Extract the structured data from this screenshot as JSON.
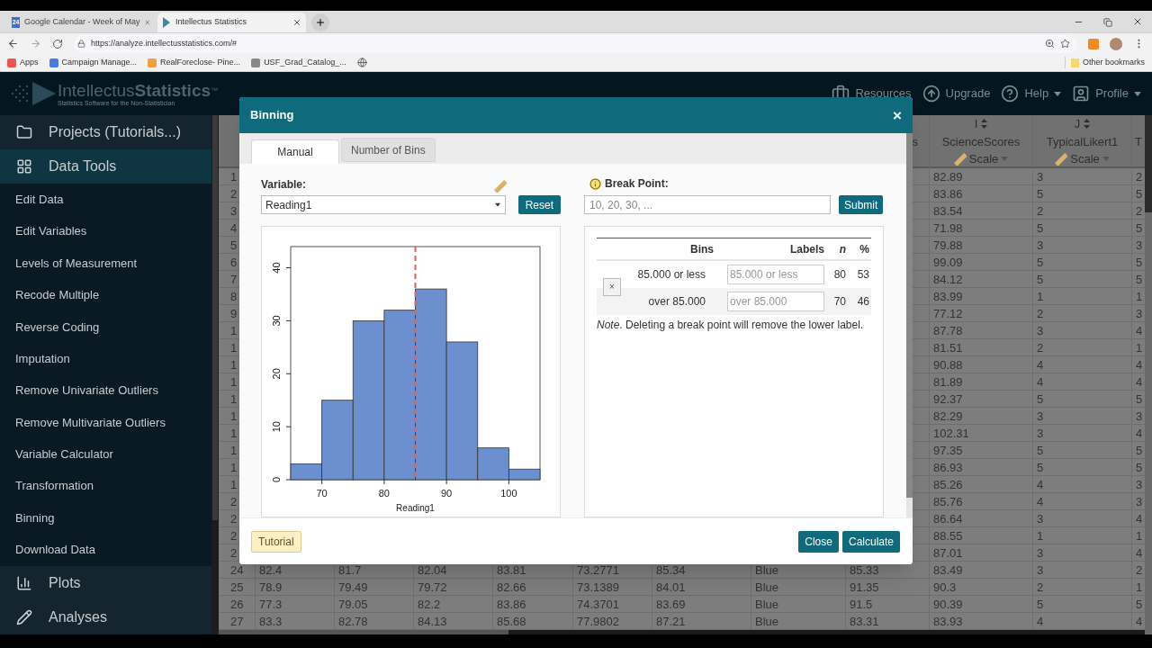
{
  "browser": {
    "tabs": [
      {
        "title": "Google Calendar - Week of May",
        "icon_text": "24",
        "selected": false
      },
      {
        "title": "Intellectus Statistics",
        "selected": true
      }
    ],
    "url": "https://analyze.intellectusstatistics.com/#",
    "bookmarks": [
      "Apps",
      "Campaign Manage...",
      "RealForeclose- Pine...",
      "USF_Grad_Catalog_..."
    ],
    "other_bookmarks": "Other bookmarks"
  },
  "app_header": {
    "logo_light": "Intellectus",
    "logo_bold": "Statistics",
    "logo_mark": "™",
    "tagline": "Statistics Software for the Non-Statistician",
    "nav": [
      {
        "label": "Resources",
        "kind": "briefcase",
        "dropdown": false
      },
      {
        "label": "Upgrade",
        "kind": "upgrade",
        "dropdown": false
      },
      {
        "label": "Help",
        "kind": "help",
        "dropdown": true
      },
      {
        "label": "Profile",
        "kind": "profile",
        "dropdown": true
      }
    ]
  },
  "sidebar": {
    "items": [
      {
        "label": "Projects (Tutorials...)",
        "kind": "folder",
        "expanded": false
      },
      {
        "label": "Data Tools",
        "kind": "grid",
        "expanded": true
      },
      {
        "label": "Edit Data",
        "kind": "item"
      },
      {
        "label": "Edit Variables",
        "kind": "item"
      },
      {
        "label": "Levels of Measurement",
        "kind": "item"
      },
      {
        "label": "Recode Multiple",
        "kind": "item"
      },
      {
        "label": "Reverse Coding",
        "kind": "item"
      },
      {
        "label": "Imputation",
        "kind": "item"
      },
      {
        "label": "Remove Univariate Outliers",
        "kind": "item"
      },
      {
        "label": "Remove Multivariate Outliers",
        "kind": "item"
      },
      {
        "label": "Variable Calculator",
        "kind": "item"
      },
      {
        "label": "Transformation",
        "kind": "item"
      },
      {
        "label": "Binning",
        "kind": "item"
      },
      {
        "label": "Download Data",
        "kind": "item"
      },
      {
        "label": "Plots",
        "kind": "chart",
        "expanded": false
      },
      {
        "label": "Analyses",
        "kind": "pencil",
        "expanded": false
      }
    ]
  },
  "table": {
    "columns": [
      {},
      {},
      {},
      {},
      {},
      {},
      {},
      {
        "name": "s"
      },
      {
        "letter": "I",
        "name": "ScienceScores",
        "measure": "Scale"
      },
      {
        "letter": "J",
        "name": "TypicalLikert1",
        "measure": "Scale"
      },
      {
        "name": "T"
      }
    ],
    "rows": [
      {
        "number": "1",
        "cells": [
          "",
          "",
          "",
          "",
          "",
          "",
          "",
          "",
          "82.89",
          "3",
          "2"
        ]
      },
      {
        "number": "2",
        "cells": [
          "",
          "",
          "",
          "",
          "",
          "",
          "",
          "",
          "83.86",
          "5",
          "5"
        ]
      },
      {
        "number": "3",
        "cells": [
          "",
          "",
          "",
          "",
          "",
          "",
          "",
          "",
          "83.54",
          "2",
          "2"
        ]
      },
      {
        "number": "4",
        "cells": [
          "",
          "",
          "",
          "",
          "",
          "",
          "",
          "",
          "71.98",
          "5",
          "5"
        ]
      },
      {
        "number": "5",
        "cells": [
          "",
          "",
          "",
          "",
          "",
          "",
          "",
          "",
          "79.88",
          "3",
          "3"
        ]
      },
      {
        "number": "6",
        "cells": [
          "",
          "",
          "",
          "",
          "",
          "",
          "",
          "",
          "99.09",
          "5",
          "5"
        ]
      },
      {
        "number": "7",
        "cells": [
          "",
          "",
          "",
          "",
          "",
          "",
          "",
          "",
          "84.12",
          "5",
          "5"
        ]
      },
      {
        "number": "8",
        "cells": [
          "",
          "",
          "",
          "",
          "",
          "",
          "",
          "",
          "83.99",
          "1",
          "1"
        ]
      },
      {
        "number": "9",
        "cells": [
          "",
          "",
          "",
          "",
          "",
          "",
          "",
          "",
          "77.12",
          "2",
          "3"
        ]
      },
      {
        "number": "1",
        "cells": [
          "",
          "",
          "",
          "",
          "",
          "",
          "",
          "",
          "87.78",
          "3",
          "4"
        ]
      },
      {
        "number": "1",
        "cells": [
          "",
          "",
          "",
          "",
          "",
          "",
          "",
          "",
          "81.51",
          "2",
          "1"
        ]
      },
      {
        "number": "1",
        "cells": [
          "",
          "",
          "",
          "",
          "",
          "",
          "",
          "",
          "90.88",
          "4",
          "4"
        ]
      },
      {
        "number": "1",
        "cells": [
          "",
          "",
          "",
          "",
          "",
          "",
          "",
          "",
          "81.89",
          "4",
          "4"
        ]
      },
      {
        "number": "1",
        "cells": [
          "",
          "",
          "",
          "",
          "",
          "",
          "",
          "",
          "92.37",
          "5",
          "5"
        ]
      },
      {
        "number": "1",
        "cells": [
          "",
          "",
          "",
          "",
          "",
          "",
          "",
          "",
          "82.29",
          "3",
          "3"
        ]
      },
      {
        "number": "1",
        "cells": [
          "",
          "",
          "",
          "",
          "",
          "",
          "",
          "",
          "102.31",
          "3",
          "4"
        ]
      },
      {
        "number": "1",
        "cells": [
          "",
          "",
          "",
          "",
          "",
          "",
          "",
          "",
          "97.35",
          "5",
          "5"
        ]
      },
      {
        "number": "1",
        "cells": [
          "",
          "",
          "",
          "",
          "",
          "",
          "",
          "",
          "86.93",
          "5",
          "5"
        ]
      },
      {
        "number": "1",
        "cells": [
          "",
          "",
          "",
          "",
          "",
          "",
          "",
          "",
          "85.26",
          "4",
          "3"
        ]
      },
      {
        "number": "2",
        "cells": [
          "",
          "",
          "",
          "",
          "",
          "",
          "",
          "",
          "85.76",
          "4",
          "3"
        ]
      },
      {
        "number": "2",
        "cells": [
          "",
          "",
          "",
          "",
          "",
          "",
          "",
          "",
          "86.64",
          "3",
          "4"
        ]
      },
      {
        "number": "2",
        "cells": [
          "",
          "",
          "",
          "",
          "",
          "",
          "",
          "",
          "88.55",
          "1",
          "1"
        ]
      },
      {
        "number": "2",
        "cells": [
          "",
          "",
          "",
          "",
          "",
          "",
          "",
          "",
          "87.01",
          "3",
          "4"
        ]
      },
      {
        "number": "24",
        "cells": [
          "82.4",
          "81.7",
          "82.04",
          "83.81",
          "73.2771",
          "85.34",
          "Blue",
          "85.33",
          "83.49",
          "3",
          "2"
        ]
      },
      {
        "number": "25",
        "cells": [
          "78.9",
          "79.49",
          "79.72",
          "82.66",
          "73.1389",
          "84.01",
          "Blue",
          "91.35",
          "90.3",
          "2",
          "1"
        ]
      },
      {
        "number": "26",
        "cells": [
          "77.3",
          "79.05",
          "82.2",
          "83.86",
          "74.3701",
          "83.69",
          "Blue",
          "91.5",
          "90.39",
          "5",
          "5"
        ]
      },
      {
        "number": "27",
        "cells": [
          "83.3",
          "82.78",
          "84.13",
          "85.68",
          "77.9802",
          "87.21",
          "Blue",
          "83.31",
          "83.93",
          "4",
          "4"
        ]
      }
    ]
  },
  "dialog": {
    "title": "Binning",
    "close": "×",
    "tabs": [
      {
        "label": "Manual",
        "selected": true
      },
      {
        "label": "Number of Bins",
        "selected": false
      }
    ],
    "variable_label": "Variable:",
    "variable_value": "Reading1",
    "reset": "Reset",
    "break_label": "Break Point:",
    "break_placeholder": "10, 20, 30, ...",
    "submit": "Submit",
    "chart_data": {
      "type": "bar",
      "xlabel": "Reading1",
      "x": [
        67.5,
        72.5,
        77.5,
        82.5,
        87.5,
        92.5,
        97.5,
        102.5
      ],
      "series": [
        {
          "color": "#6b8fcf",
          "values": [
            3,
            15,
            30,
            32,
            36,
            26,
            6,
            2
          ]
        }
      ],
      "xlim": [
        65,
        105
      ],
      "ylim": [
        0,
        44
      ],
      "xticks": [
        {
          "value": 70,
          "label": "70"
        },
        {
          "value": 80,
          "label": "80"
        },
        {
          "value": 90,
          "label": "90"
        },
        {
          "value": 100,
          "label": "100"
        }
      ],
      "yticks": [
        {
          "value": 0,
          "label": "0"
        },
        {
          "value": 10,
          "label": "10"
        },
        {
          "value": 20,
          "label": "20"
        },
        {
          "value": 30,
          "label": "30"
        },
        {
          "value": 40,
          "label": "40"
        }
      ],
      "ref_lines": [
        {
          "axis": "x",
          "value": 85,
          "color": "#e0605a"
        }
      ]
    },
    "bins_table": {
      "columns": [
        "Bins",
        "Labels",
        "n",
        "%"
      ],
      "delete": "×",
      "rows": [
        {
          "bin": "85.000 or less",
          "label_placeholder": "85.000 or less",
          "n": "80",
          "pct": "53"
        },
        {
          "bin": "over 85.000",
          "label_placeholder": "over 85.000",
          "n": "70",
          "pct": "46"
        }
      ],
      "note": "*Note*. Deleting a break point will remove the lower label."
    },
    "tutorial": "Tutorial",
    "close_button": "Close",
    "calculate": "Calculate"
  }
}
